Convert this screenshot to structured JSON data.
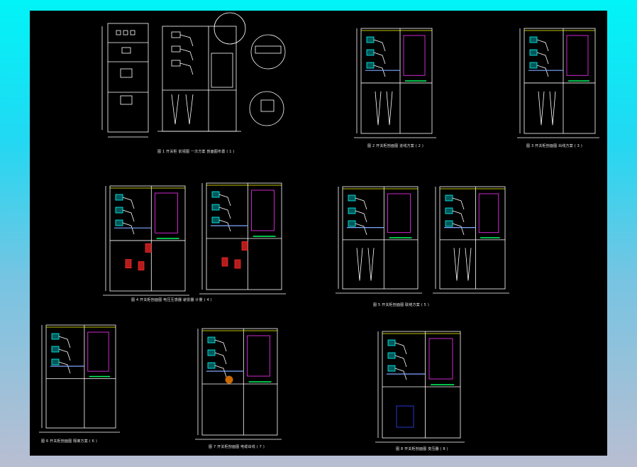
{
  "window": {
    "background_top": "#00f4f8",
    "background_bottom": "#b9bed2",
    "canvas_color": "#000000"
  },
  "colors": {
    "outline": "#ffffff",
    "busbar": "#00ffff",
    "breaker": "#ff2a2a",
    "ground": "#00ff66",
    "cable": "#7fa6ff",
    "door": "#ff33ff",
    "accent": "#ffff00",
    "orange": "#cc6a00",
    "blue": "#3344ff"
  },
  "captions": {
    "d1": "图 1 开关柜  前视图 一次方案 剖面图布置  ( 1 )",
    "d2": "图 2  开关柜剖面图 进线方案  ( 2 )",
    "d3": "图 3  开关柜剖面图 出线方案  ( 3 )",
    "d4": "图 4  开关柜剖面图 电压互感器 避雷器 计量  ( 4 )",
    "d5": "图 5  开关柜剖面图 联络方案  ( 5 )",
    "d6": "图 6  开关柜剖面图 隔离方案  ( 6 )",
    "d7": "图 7  开关柜剖面图 电缆出线  ( 7 )",
    "d8": "图 8  开关柜剖面图 变压器  ( 8 )"
  }
}
